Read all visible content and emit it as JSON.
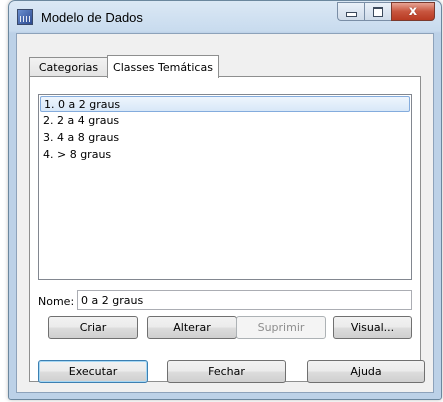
{
  "window": {
    "title": "Modelo de Dados",
    "icon": "grid-chart-icon",
    "controls": {
      "minimize": "minimize-icon",
      "maximize": "maximize-icon",
      "close": "close-icon",
      "close_glyph": "x"
    }
  },
  "tabs": [
    {
      "label": "Categorias",
      "active": false
    },
    {
      "label": "Classes Temáticas",
      "active": true
    }
  ],
  "classes": {
    "items": [
      {
        "label": "1. 0 a 2 graus",
        "selected": true
      },
      {
        "label": "2. 2 a 4 graus",
        "selected": false
      },
      {
        "label": "3. 4 a 8 graus",
        "selected": false
      },
      {
        "label": "4. > 8 graus",
        "selected": false
      }
    ],
    "nome_label": "Nome:",
    "nome_value": "0 a 2 graus",
    "buttons": {
      "criar": "Criar",
      "alterar": "Alterar",
      "suprimir": "Suprimir",
      "visual": "Visual..."
    }
  },
  "footer": {
    "executar": "Executar",
    "fechar": "Fechar",
    "ajuda": "Ajuda"
  },
  "colors": {
    "selection_border": "#84acdd",
    "default_button_border": "#3c7fb1",
    "close_button": "#c8553e"
  }
}
